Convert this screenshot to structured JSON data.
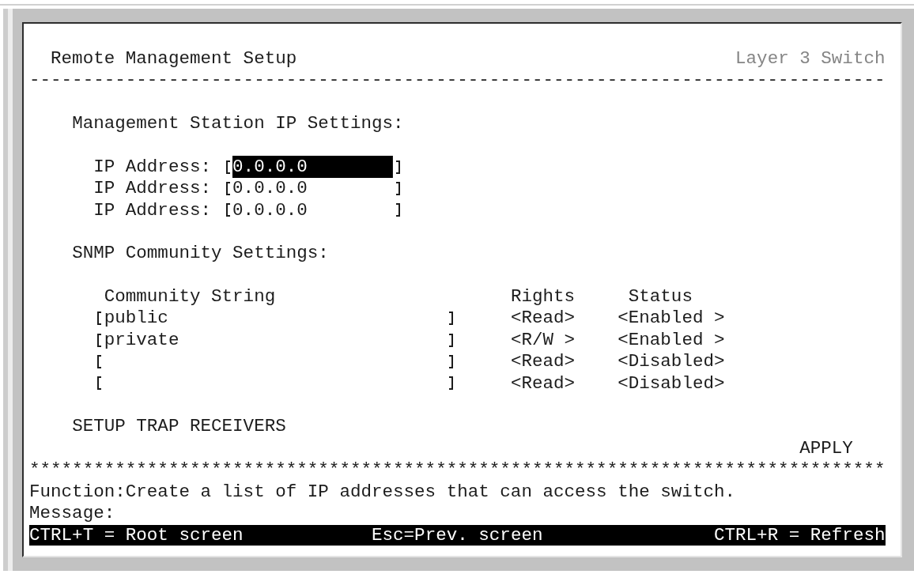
{
  "screen": {
    "title": "Remote Management Setup",
    "device": "Layer 3 Switch",
    "title_rule": "--------------------------------------------------------------------------------"
  },
  "management_station": {
    "heading": "Management Station IP Settings:",
    "ip_addresses": [
      {
        "label": "IP Address:",
        "value": "0.0.0.0",
        "focused": true
      },
      {
        "label": "IP Address:",
        "value": "0.0.0.0",
        "focused": false
      },
      {
        "label": "IP Address:",
        "value": "0.0.0.0",
        "focused": false
      }
    ]
  },
  "snmp_community": {
    "heading": "SNMP Community Settings:",
    "columns": [
      "Community String",
      "Rights",
      "Status"
    ],
    "rows": [
      {
        "community_string": "public",
        "rights": "<Read>",
        "status": "<Enabled >"
      },
      {
        "community_string": "private",
        "rights": "<R/W >",
        "status": "<Enabled >"
      },
      {
        "rights": "<Read>",
        "status": "<Disabled>"
      },
      {
        "rights": "<Read>",
        "status": "<Disabled>"
      }
    ]
  },
  "trap_receivers_link": "SETUP TRAP RECEIVERS",
  "apply_button": "APPLY",
  "footer_rule": "********************************************************************************",
  "function_line": "Function:Create a list of IP addresses that can access the switch.",
  "message_label": "Message:",
  "key_bar": [
    "CTRL+T = Root screen",
    "Esc=Prev. screen",
    "CTRL+R = Refresh"
  ]
}
